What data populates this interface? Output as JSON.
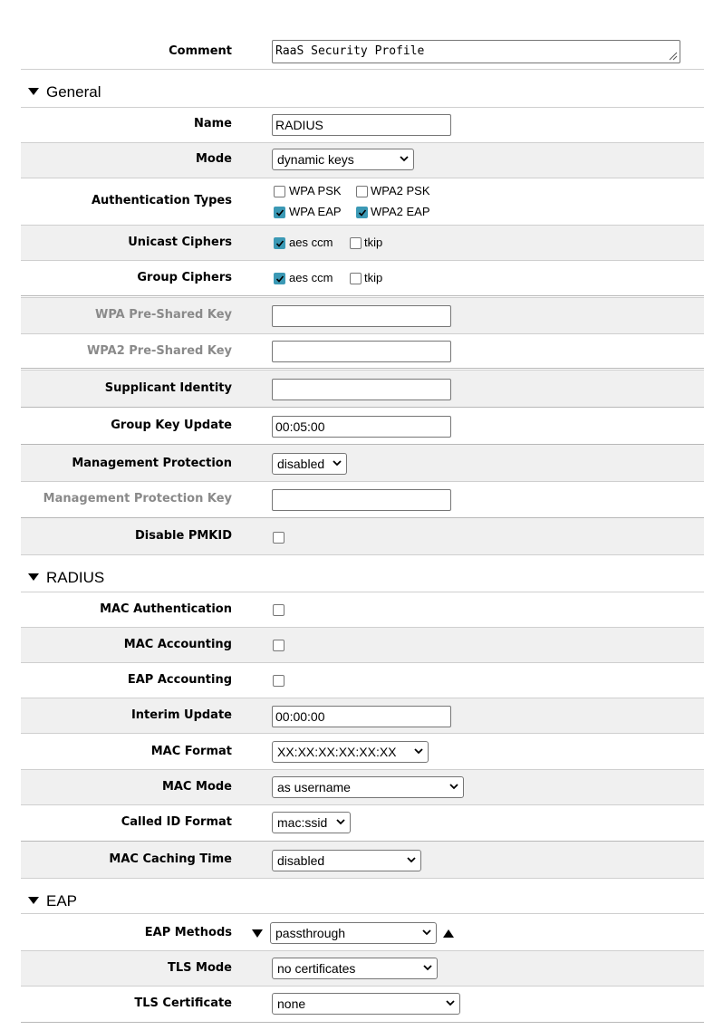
{
  "comment": {
    "label": "Comment",
    "value": "RaaS Security Profile"
  },
  "general": {
    "title": "General",
    "name": {
      "label": "Name",
      "value": "RADIUS"
    },
    "mode": {
      "label": "Mode",
      "value": "dynamic keys"
    },
    "auth_types": {
      "label": "Authentication Types",
      "wpa_psk": "WPA PSK",
      "wpa2_psk": "WPA2 PSK",
      "wpa_eap": "WPA EAP",
      "wpa2_eap": "WPA2 EAP",
      "checked": {
        "wpa_psk": false,
        "wpa2_psk": false,
        "wpa_eap": true,
        "wpa2_eap": true
      }
    },
    "unicast": {
      "label": "Unicast Ciphers",
      "aes": "aes ccm",
      "tkip": "tkip",
      "aes_checked": true,
      "tkip_checked": false
    },
    "group": {
      "label": "Group Ciphers",
      "aes": "aes ccm",
      "tkip": "tkip",
      "aes_checked": true,
      "tkip_checked": false
    },
    "wpa_psk_key": {
      "label": "WPA Pre-Shared Key",
      "value": ""
    },
    "wpa2_psk_key": {
      "label": "WPA2 Pre-Shared Key",
      "value": ""
    },
    "supplicant": {
      "label": "Supplicant Identity",
      "value": ""
    },
    "group_key_update": {
      "label": "Group Key Update",
      "value": "00:05:00"
    },
    "mgmt_protection": {
      "label": "Management Protection",
      "value": "disabled"
    },
    "mgmt_protection_key": {
      "label": "Management Protection Key",
      "value": ""
    },
    "disable_pmkid": {
      "label": "Disable PMKID",
      "checked": false
    }
  },
  "radius": {
    "title": "RADIUS",
    "mac_auth": {
      "label": "MAC Authentication",
      "checked": false
    },
    "mac_accounting": {
      "label": "MAC Accounting",
      "checked": false
    },
    "eap_accounting": {
      "label": "EAP Accounting",
      "checked": false
    },
    "interim_update": {
      "label": "Interim Update",
      "value": "00:00:00"
    },
    "mac_format": {
      "label": "MAC Format",
      "value": "XX:XX:XX:XX:XX:XX"
    },
    "mac_mode": {
      "label": "MAC Mode",
      "value": "as username"
    },
    "called_id_format": {
      "label": "Called ID Format",
      "value": "mac:ssid"
    },
    "mac_caching_time": {
      "label": "MAC Caching Time",
      "value": "disabled"
    }
  },
  "eap": {
    "title": "EAP",
    "methods": {
      "label": "EAP Methods",
      "value": "passthrough"
    },
    "tls_mode": {
      "label": "TLS Mode",
      "value": "no certificates"
    },
    "tls_cert": {
      "label": "TLS Certificate",
      "value": "none"
    }
  },
  "colors": {
    "accent": "#3b99b5",
    "row_bg": "#f0f0f0",
    "dim_label": "#8a8a8a"
  }
}
